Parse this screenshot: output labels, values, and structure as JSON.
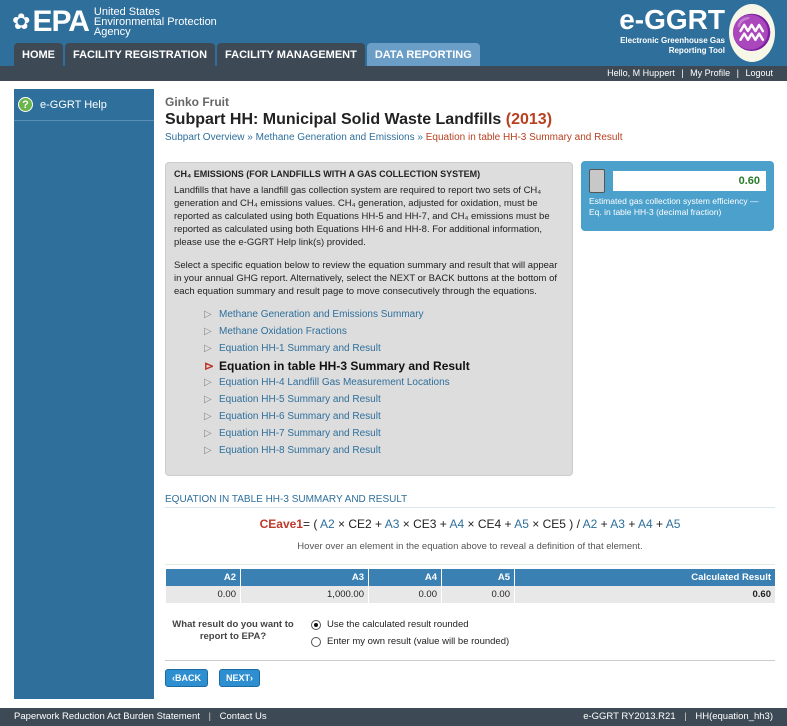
{
  "header": {
    "epa": "EPA",
    "epa_agency": [
      "United States",
      "Environmental Protection",
      "Agency"
    ],
    "app_title": "e-GGRT",
    "app_subtitle": [
      "Electronic Greenhouse Gas",
      "Reporting Tool"
    ]
  },
  "nav": {
    "tabs": [
      "HOME",
      "FACILITY REGISTRATION",
      "FACILITY MANAGEMENT",
      "DATA REPORTING"
    ],
    "active": "DATA REPORTING"
  },
  "userbar": {
    "hello": "Hello, M Huppert",
    "sep1": "|",
    "profile": "My Profile",
    "sep2": "|",
    "logout": "Logout"
  },
  "sidebar": {
    "help": "e-GGRT Help"
  },
  "page": {
    "facility": "Ginko Fruit",
    "title": "Subpart HH: Municipal Solid Waste Landfills",
    "year": "(2013)",
    "breadcrumb": {
      "a": "Subpart Overview",
      "sep": "»",
      "b": "Methane Generation and Emissions",
      "c": "Equation in table HH-3 Summary and Result"
    }
  },
  "info": {
    "heading": "CH₄ EMISSIONS (FOR LANDFILLS WITH A GAS COLLECTION SYSTEM)",
    "para1": "Landfills that have a landfill gas collection system are required to report two sets of CH₄ generation and CH₄ emissions values. CH₄ generation, adjusted for oxidation, must be reported as calculated using both Equations HH-5 and HH-7, and CH₄ emissions must be reported as calculated using both Equations HH-6 and HH-8. For additional information, please use the e-GGRT Help link(s) provided.",
    "para2": "Select a specific equation below to review the equation summary and result that will appear in your annual GHG report. Alternatively, select the NEXT or BACK buttons at the bottom of each equation summary and result page to move consecutively through the equations.",
    "links": [
      "Methane Generation and Emissions Summary",
      "Methane Oxidation Fractions",
      "Equation HH-1 Summary and Result",
      "Equation in table HH-3 Summary and Result",
      "Equation HH-4 Landfill Gas Measurement Locations",
      "Equation HH-5 Summary and Result",
      "Equation HH-6 Summary and Result",
      "Equation HH-7 Summary and Result",
      "Equation HH-8 Summary and Result"
    ],
    "current_index": 3
  },
  "result": {
    "value": "0.60",
    "desc": "Estimated gas collection system efficiency — Eq. in table HH-3 (decimal fraction)"
  },
  "equation": {
    "header": "EQUATION IN TABLE HH-3 SUMMARY AND RESULT",
    "lhs": "CEave1",
    "hint": "Hover over an element in the equation above to reveal a definition of that element."
  },
  "table": {
    "headers": [
      "A2",
      "A3",
      "A4",
      "A5",
      "Calculated Result"
    ],
    "row": [
      "0.00",
      "1,000.00",
      "0.00",
      "0.00",
      "0.60"
    ]
  },
  "choose": {
    "question": "What result do you want to report to EPA?",
    "options": [
      "Use the calculated result rounded",
      "Enter my own result (value will be rounded)"
    ],
    "selected": 0
  },
  "buttons": {
    "back": "BACK",
    "next": "NEXT"
  },
  "footer": {
    "left1": "Paperwork Reduction Act Burden Statement",
    "left2": "Contact Us",
    "right1": "e-GGRT RY2013.R21",
    "right2": "HH(equation_hh3)"
  }
}
